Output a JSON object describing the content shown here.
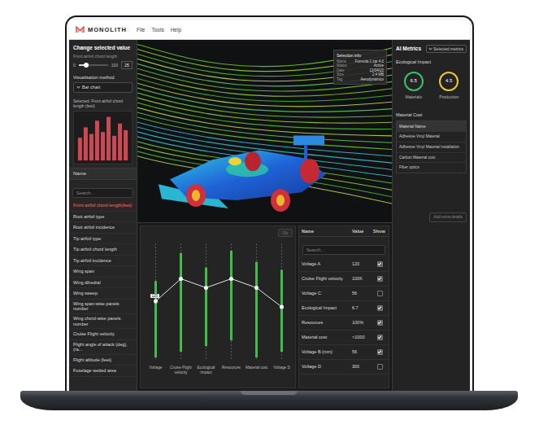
{
  "window": {
    "logo": "MONOLITH",
    "menu": [
      "File",
      "Tools",
      "Help"
    ]
  },
  "control": {
    "title": "Change selected value",
    "parameter": "Front airfoil chord length",
    "slider": {
      "min": "0",
      "max": "100",
      "value": "25",
      "level": 0.25
    },
    "method_label": "Visualisation method",
    "method": "Bar chart",
    "chart_title": "Selected: Front airfoil chord length (feet)",
    "chart": {
      "values": [
        48,
        70,
        56,
        84,
        60,
        92,
        52,
        78,
        64
      ]
    }
  },
  "parameters": {
    "header": "Name",
    "search": {
      "placeholder": "Search..."
    },
    "items": [
      {
        "label": "Front airfoil chord length(feet)",
        "selected": true
      },
      {
        "label": "Root airfoil type",
        "selected": false
      },
      {
        "label": "Root airfoil incidence",
        "selected": false
      },
      {
        "label": "Tip airfoil type",
        "selected": false
      },
      {
        "label": "Tip airfoil chord length",
        "selected": false
      },
      {
        "label": "Tip airfoil incidence",
        "selected": false
      },
      {
        "label": "Wing span",
        "selected": false
      },
      {
        "label": "Wing dihedral",
        "selected": false
      },
      {
        "label": "Wing sweep",
        "selected": false
      },
      {
        "label": "Wing span-wise panels number",
        "selected": false
      },
      {
        "label": "Wing chord-wise panels number",
        "selected": false
      },
      {
        "label": "Cruise Flight velocity",
        "selected": false
      },
      {
        "label": "Flight angle of attack (deg), (ra...",
        "selected": false
      },
      {
        "label": "Flight altitude (feet)",
        "selected": false
      },
      {
        "label": "Fuselage wetted area",
        "selected": false
      }
    ]
  },
  "viewer": {
    "info": {
      "title": "Selection info",
      "rows": [
        {
          "key": "Name",
          "value": "Formula 1 car 4.0"
        },
        {
          "key": "Status",
          "value": "Active"
        },
        {
          "key": "Date",
          "value": "12/04/22"
        },
        {
          "key": "Size",
          "value": "2.4 MB"
        },
        {
          "key": "Tag",
          "value": "Aerodynamics"
        }
      ]
    }
  },
  "parallel": {
    "button": {
      "label": "Ok",
      "disabled": true
    },
    "tag": "120",
    "axes": [
      {
        "label": "Voltage",
        "level": 0.5,
        "band": [
          0.0,
          0.68
        ]
      },
      {
        "label": "Cruise Flight velocity",
        "level": 0.7,
        "band": [
          0.05,
          0.93
        ]
      },
      {
        "label": "Ecological Impact",
        "level": 0.62,
        "band": [
          0.1,
          0.8
        ]
      },
      {
        "label": "Resources",
        "level": 0.7,
        "band": [
          0.15,
          0.95
        ]
      },
      {
        "label": "Material cost",
        "level": 0.62,
        "band": [
          0.0,
          0.85
        ]
      },
      {
        "label": "Voltage S",
        "level": 0.45,
        "band": [
          0.05,
          0.78
        ]
      }
    ]
  },
  "table": {
    "columns": [
      "Name",
      "Value",
      "Show"
    ],
    "search": {
      "placeholder": "Search..."
    },
    "rows": [
      {
        "name": "Voltage A",
        "value": "120",
        "show": true
      },
      {
        "name": "Cruise Flight velocity",
        "value": "100K",
        "show": true
      },
      {
        "name": "Voltage C",
        "value": "56",
        "show": false
      },
      {
        "name": "Ecological Impact",
        "value": "6.7",
        "show": true
      },
      {
        "name": "Resources",
        "value": "100%",
        "show": true
      },
      {
        "name": "Material cost",
        "value": ">1000",
        "show": true
      },
      {
        "name": "Voltage B (mm)",
        "value": "56",
        "show": true
      },
      {
        "name": "Voltage D",
        "value": "300",
        "show": false
      }
    ]
  },
  "metrics": {
    "title": "AI Metrics",
    "dropdown": "Selected metrics",
    "section": "Ecological Impact",
    "gauges": [
      {
        "value": "6.5",
        "label": "Materials",
        "color": "#3cbf6d"
      },
      {
        "value": "4.5",
        "label": "Production",
        "color": "#e8c83a"
      }
    ],
    "cost_title": "Material Cost",
    "cost_header": "Material Name",
    "cost_items": [
      "Adhesive Vinyl Material",
      "Adhesive Vinyl Material Installation",
      "Carbon Material cost",
      "Fiber optics"
    ],
    "extra": "Add extra details"
  }
}
